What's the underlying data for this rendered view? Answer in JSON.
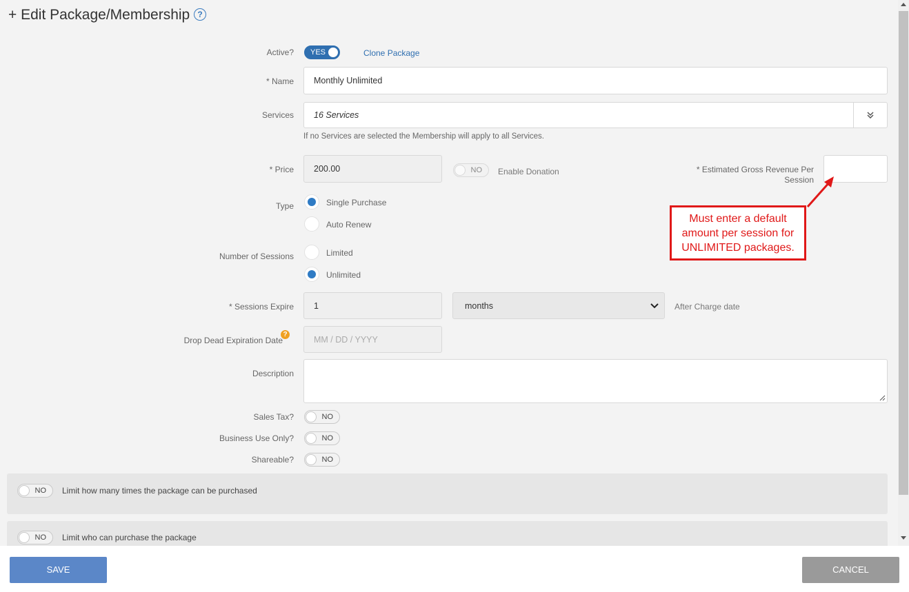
{
  "header": {
    "title": "+ Edit Package/Membership",
    "help_icon": "?"
  },
  "form": {
    "active": {
      "label": "Active?",
      "toggle": "YES"
    },
    "clone_link": "Clone Package",
    "name": {
      "label": "* Name",
      "value": "Monthly Unlimited"
    },
    "services": {
      "label": "Services",
      "value": "16 Services",
      "helper": "If no Services are selected the Membership will apply to all Services."
    },
    "price": {
      "label": "* Price",
      "value": "200.00"
    },
    "donation": {
      "toggle": "NO",
      "label": "Enable Donation"
    },
    "est_revenue": {
      "label_line1": "* Estimated Gross Revenue Per",
      "label_line2": "Session",
      "value": ""
    },
    "type": {
      "label": "Type",
      "options": [
        "Single Purchase",
        "Auto Renew"
      ],
      "selected": "Single Purchase"
    },
    "sessions": {
      "label": "Number of Sessions",
      "options": [
        "Limited",
        "Unlimited"
      ],
      "selected": "Unlimited"
    },
    "expire": {
      "label": "* Sessions Expire",
      "value": "1",
      "unit": "months",
      "suffix": "After Charge date"
    },
    "drop_dead": {
      "label": "Drop Dead Expiration Date",
      "help_icon": "?",
      "placeholder": "MM / DD / YYYY"
    },
    "description": {
      "label": "Description",
      "value": ""
    },
    "sales_tax": {
      "label": "Sales Tax?",
      "toggle": "NO"
    },
    "business_use": {
      "label": "Business Use Only?",
      "toggle": "NO"
    },
    "shareable": {
      "label": "Shareable?",
      "toggle": "NO"
    }
  },
  "panels": [
    {
      "toggle": "NO",
      "label": "Limit how many times the package can be purchased"
    },
    {
      "toggle": "NO",
      "label": "Limit who can purchase the package"
    }
  ],
  "callout": {
    "line1": "Must enter a default",
    "line2": "amount per session for",
    "line3": "UNLIMITED packages.",
    "color": "#e01818"
  },
  "footer": {
    "save": "SAVE",
    "cancel": "CANCEL"
  },
  "colors": {
    "accent": "#2f6fb0",
    "save": "#5b87c8",
    "cancel": "#9a9a9a"
  }
}
